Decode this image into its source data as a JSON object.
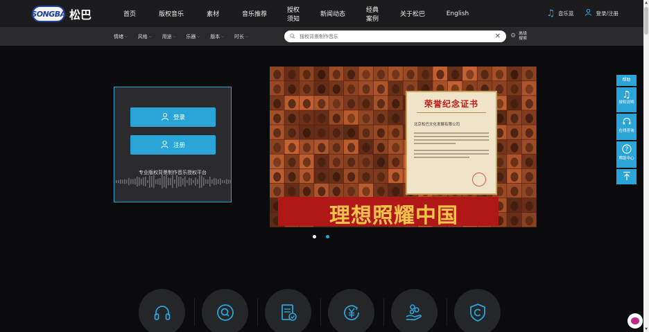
{
  "brand": {
    "logo_text": "SONGBA",
    "name": "松巴"
  },
  "nav": {
    "items": [
      "首页",
      "版权音乐",
      "素材",
      "音乐推荐",
      "授权须知",
      "新闻动态",
      "经典案例",
      "关于松巴",
      "English"
    ],
    "music_list": "音乐篮",
    "login_register": "登录/注册"
  },
  "filters": {
    "items": [
      "情绪",
      "风格",
      "用途",
      "乐器",
      "版本",
      "时长"
    ],
    "search_placeholder": "搜权背景制作音乐",
    "advanced_search": "高级搜索"
  },
  "login_box": {
    "login": "登录",
    "register": "注册",
    "tagline": "专业版权背景制作音乐授权平台"
  },
  "banner": {
    "certificate_title": "荣誉纪念证书",
    "certificate_company": "北京松巴文化发展有限公司",
    "slogan": "理想照耀中国",
    "slide_count": 2,
    "active_slide": 2
  },
  "side_float": {
    "help_label": "帮助",
    "items": [
      {
        "icon": "music-note-icon",
        "label": "授权说明"
      },
      {
        "icon": "headset-icon",
        "label": "在线咨询"
      },
      {
        "icon": "question-icon",
        "label": "帮助中心"
      },
      {
        "icon": "back-to-top-icon",
        "label": ""
      }
    ]
  },
  "features": {
    "icons": [
      "headphones-icon",
      "search-icon",
      "document-check-icon",
      "yen-icon",
      "hand-coins-icon",
      "copyright-shield-icon"
    ]
  },
  "colors": {
    "accent": "#2ba4d8",
    "nav_bg": "#1c1c1f",
    "filter_bg": "#2a2a2d",
    "page_bg": "#0b0b0d",
    "slogan": "#f3c24a",
    "band": "#b01818"
  }
}
